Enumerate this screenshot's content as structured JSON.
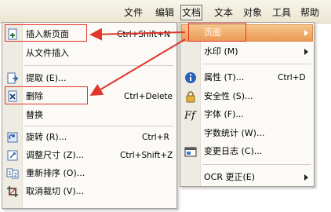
{
  "menubar": {
    "items": [
      "文件",
      "编辑",
      "文档",
      "文本",
      "对象",
      "工具",
      "帮助"
    ],
    "active": "文档"
  },
  "left_menu": {
    "items": [
      {
        "label": "插入新页面",
        "shortcut": "Ctrl+Shift+N",
        "icon": "insert-page-icon"
      },
      {
        "label": "从文件插入",
        "shortcut": "",
        "icon": ""
      },
      {
        "label": "提取 (E)...",
        "shortcut": "",
        "icon": "extract-page-icon"
      },
      {
        "label": "删除",
        "shortcut": "Ctrl+Delete",
        "icon": "delete-page-icon"
      },
      {
        "label": "替换",
        "shortcut": "",
        "icon": ""
      },
      {
        "label": "旋转 (R)...",
        "shortcut": "Ctrl+R",
        "icon": "rotate-page-icon"
      },
      {
        "label": "调整尺寸 (Z)...",
        "shortcut": "Ctrl+Shift+Z",
        "icon": "resize-page-icon"
      },
      {
        "label": "重新排序 (O)...",
        "shortcut": "",
        "icon": "reorder-pages-icon"
      },
      {
        "label": "取消裁切 (V)...",
        "shortcut": "",
        "icon": "uncrop-icon"
      }
    ]
  },
  "right_menu": {
    "items": [
      {
        "label": "页面",
        "shortcut": "",
        "icon": "",
        "submenu": true
      },
      {
        "label": "水印 (M)",
        "shortcut": "",
        "icon": "",
        "submenu": true
      },
      {
        "label": "属性 (T)...",
        "shortcut": "Ctrl+D",
        "icon": "info-icon"
      },
      {
        "label": "安全性 (S)...",
        "shortcut": "",
        "icon": "lock-icon"
      },
      {
        "label": "字体 (F)...",
        "shortcut": "",
        "icon": "font-icon"
      },
      {
        "label": "字数统计 (W)...",
        "shortcut": "",
        "icon": ""
      },
      {
        "label": "变更日志 (C)...",
        "shortcut": "",
        "icon": "changelog-icon"
      },
      {
        "label": "OCR 更正(E)",
        "shortcut": "",
        "icon": "",
        "submenu": true
      }
    ]
  },
  "colors": {
    "highlight_border": "#e0362c",
    "submenu_highlight": "#ec9a55",
    "arrow": "#e0362c"
  }
}
